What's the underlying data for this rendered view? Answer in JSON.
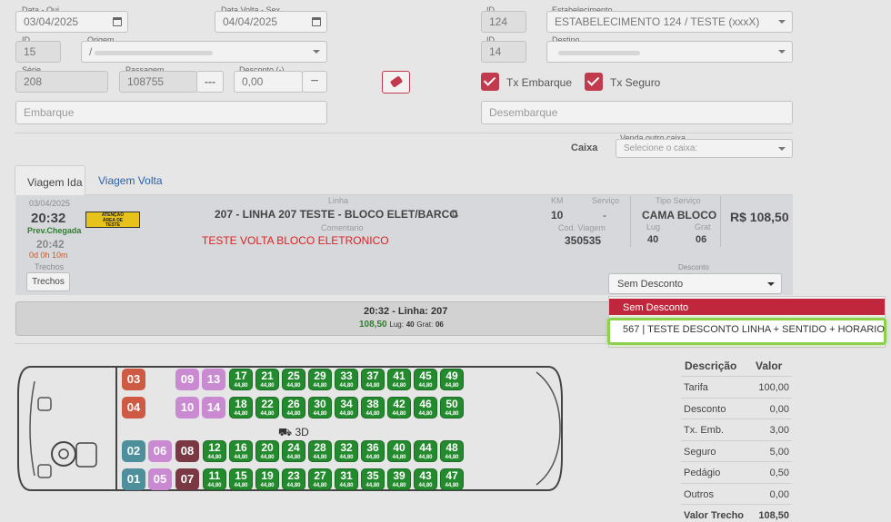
{
  "form": {
    "data_ida_label": "Data - Qui",
    "data_ida_value": "03/04/2025",
    "data_volta_label": "Data Volta - Sex",
    "data_volta_value": "04/04/2025",
    "id_origem_label": "ID",
    "id_origem_value": "15",
    "origem_label": "Origem",
    "origem_value": "/",
    "serie_label": "Série",
    "serie_value": "208",
    "passagem_label": "Passagem",
    "passagem_value": "108755",
    "passagem_btn": "---",
    "desconto_label": "Desconto (-)",
    "desconto_value": "0,00",
    "desconto_btn": "−",
    "embarque_placeholder": "Embarque",
    "id_estab_label": "ID",
    "id_estab_value": "124",
    "estab_label": "Estabelecimento",
    "estab_value": "ESTABELECIMENTO 124 / TESTE (xxxX)",
    "id_destino_label": "ID",
    "id_destino_value": "14",
    "destino_label": "Destino",
    "destino_value": "",
    "tx_embarque_label": "Tx Embarque",
    "tx_seguro_label": "Tx Seguro",
    "desembarque_placeholder": "Desembarque",
    "caixa_label": "Caixa",
    "venda_outro_caixa_label": "Venda outro caixa",
    "venda_outro_caixa_placeholder": "Selecione o caixa:"
  },
  "tabs": [
    {
      "label": "Viagem Ida"
    },
    {
      "label": "Viagem Volta"
    }
  ],
  "trip": {
    "date": "03/04/2025",
    "time": "20:32",
    "prev_chegada_label": "Prev.Chegada",
    "arrival": "20:42",
    "duration": "0d 0h 10m",
    "badge_line1": "ATENÇÃO",
    "badge_line2": "ÁREA DE",
    "badge_line3": "TESTE",
    "linha_label": "Linha",
    "linha_value": "207 - LINHA 207 TESTE - BLOCO ELET/BARCO",
    "comentario_label": "Comentario",
    "comentario_value": "TESTE VOLTA BLOCO ELETRONICO",
    "km_label": "KM",
    "km_value": "10",
    "servico_label": "Serviço",
    "servico_value": "-",
    "cod_viagem_label": "Cod. Viagem",
    "cod_viagem_value": "350535",
    "tipo_servico_label": "Tipo Serviço",
    "tipo_servico_value": "CAMA BLOCO",
    "lug_label": "Lug",
    "lug_value": "40",
    "grat_label": "Grat",
    "grat_value": "06",
    "price": "R$ 108,50",
    "trechos_label": "Trechos",
    "trechos_btn": "Trechos",
    "desconto_label": "Desconto",
    "desconto_selected": "Sem Desconto"
  },
  "desconto_options": [
    "Sem Desconto",
    "567 | TESTE DESCONTO LINHA + SENTIDO + HORARIO"
  ],
  "summary": {
    "title": "20:32 - Linha: 207",
    "price": "108,50",
    "lug_label": "Lug:",
    "lug_value": "40",
    "grat_label": "Grat:",
    "grat_value": "06"
  },
  "bus": {
    "floor_label": "3D",
    "seat_price": "44,80",
    "special_seats": [
      {
        "n": "03",
        "color": "#cf5a43"
      },
      {
        "n": "04",
        "color": "#cf5a43"
      },
      {
        "n": "09",
        "color": "#c98ad2"
      },
      {
        "n": "13",
        "color": "#c98ad2"
      },
      {
        "n": "10",
        "color": "#c98ad2"
      },
      {
        "n": "14",
        "color": "#c98ad2"
      },
      {
        "n": "02",
        "color": "#4e8f9c"
      },
      {
        "n": "06",
        "color": "#c98ad2"
      },
      {
        "n": "08",
        "color": "#7a3842"
      },
      {
        "n": "01",
        "color": "#4e8f9c"
      },
      {
        "n": "05",
        "color": "#c98ad2"
      },
      {
        "n": "07",
        "color": "#7a3842"
      }
    ],
    "green_rows": [
      [
        "17",
        "21",
        "25",
        "29",
        "33",
        "37",
        "41",
        "45",
        "49"
      ],
      [
        "18",
        "22",
        "26",
        "30",
        "34",
        "38",
        "42",
        "46",
        "50"
      ],
      [
        "12",
        "16",
        "20",
        "24",
        "28",
        "32",
        "36",
        "40",
        "44",
        "48"
      ],
      [
        "11",
        "15",
        "19",
        "23",
        "27",
        "31",
        "35",
        "39",
        "43",
        "47"
      ]
    ]
  },
  "values_table": {
    "header_desc": "Descrição",
    "header_val": "Valor",
    "rows": [
      {
        "d": "Tarifa",
        "v": "100,00"
      },
      {
        "d": "Desconto",
        "v": "0,00"
      },
      {
        "d": "Tx. Emb.",
        "v": "3,00"
      },
      {
        "d": "Seguro",
        "v": "5,00"
      },
      {
        "d": "Pedágio",
        "v": "0,50"
      },
      {
        "d": "Outros",
        "v": "0,00"
      },
      {
        "d": "Valor Trecho",
        "v": "108,50"
      }
    ]
  },
  "colors": {
    "accent_red": "#c23a4e",
    "seat_green": "#238a2e",
    "highlight_green": "#8bd14b"
  }
}
